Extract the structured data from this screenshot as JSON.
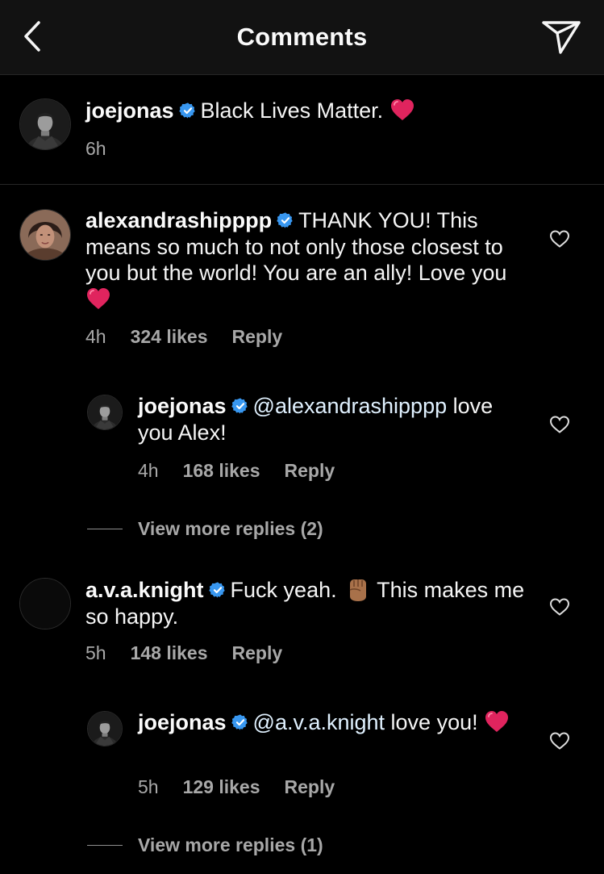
{
  "header": {
    "title": "Comments",
    "back_icon": "chevron-left-icon",
    "send_icon": "paper-plane-icon"
  },
  "caption": {
    "username": "joejonas",
    "text": "Black Lives Matter.",
    "time": "6h"
  },
  "comments": [
    {
      "username": "alexandrashipppp",
      "text": "THANK YOU! This means so much to not only those closest to you but the world! You are an ally! Love you",
      "time": "4h",
      "likes": "324 likes",
      "reply_label": "Reply",
      "replies": [
        {
          "username": "joejonas",
          "mention": "@alexandrashipppp",
          "text": "love you Alex!",
          "time": "4h",
          "likes": "168 likes",
          "reply_label": "Reply"
        }
      ],
      "view_more": "View more replies (2)"
    },
    {
      "username": "a.v.a.knight",
      "text_before_emoji": "Fuck yeah.",
      "text_after_emoji": "This makes me so happy.",
      "time": "5h",
      "likes": "148 likes",
      "reply_label": "Reply",
      "replies": [
        {
          "username": "joejonas",
          "mention": "@a.v.a.knight",
          "text": "love you!",
          "time": "5h",
          "likes": "129 likes",
          "reply_label": "Reply"
        }
      ],
      "view_more": "View more replies (1)"
    }
  ],
  "colors": {
    "background": "#000000",
    "header_bg": "#121212",
    "text": "#f5f5f5",
    "secondary": "#a8a8a8",
    "verified": "#3897f0",
    "heart": "#e0245e"
  }
}
